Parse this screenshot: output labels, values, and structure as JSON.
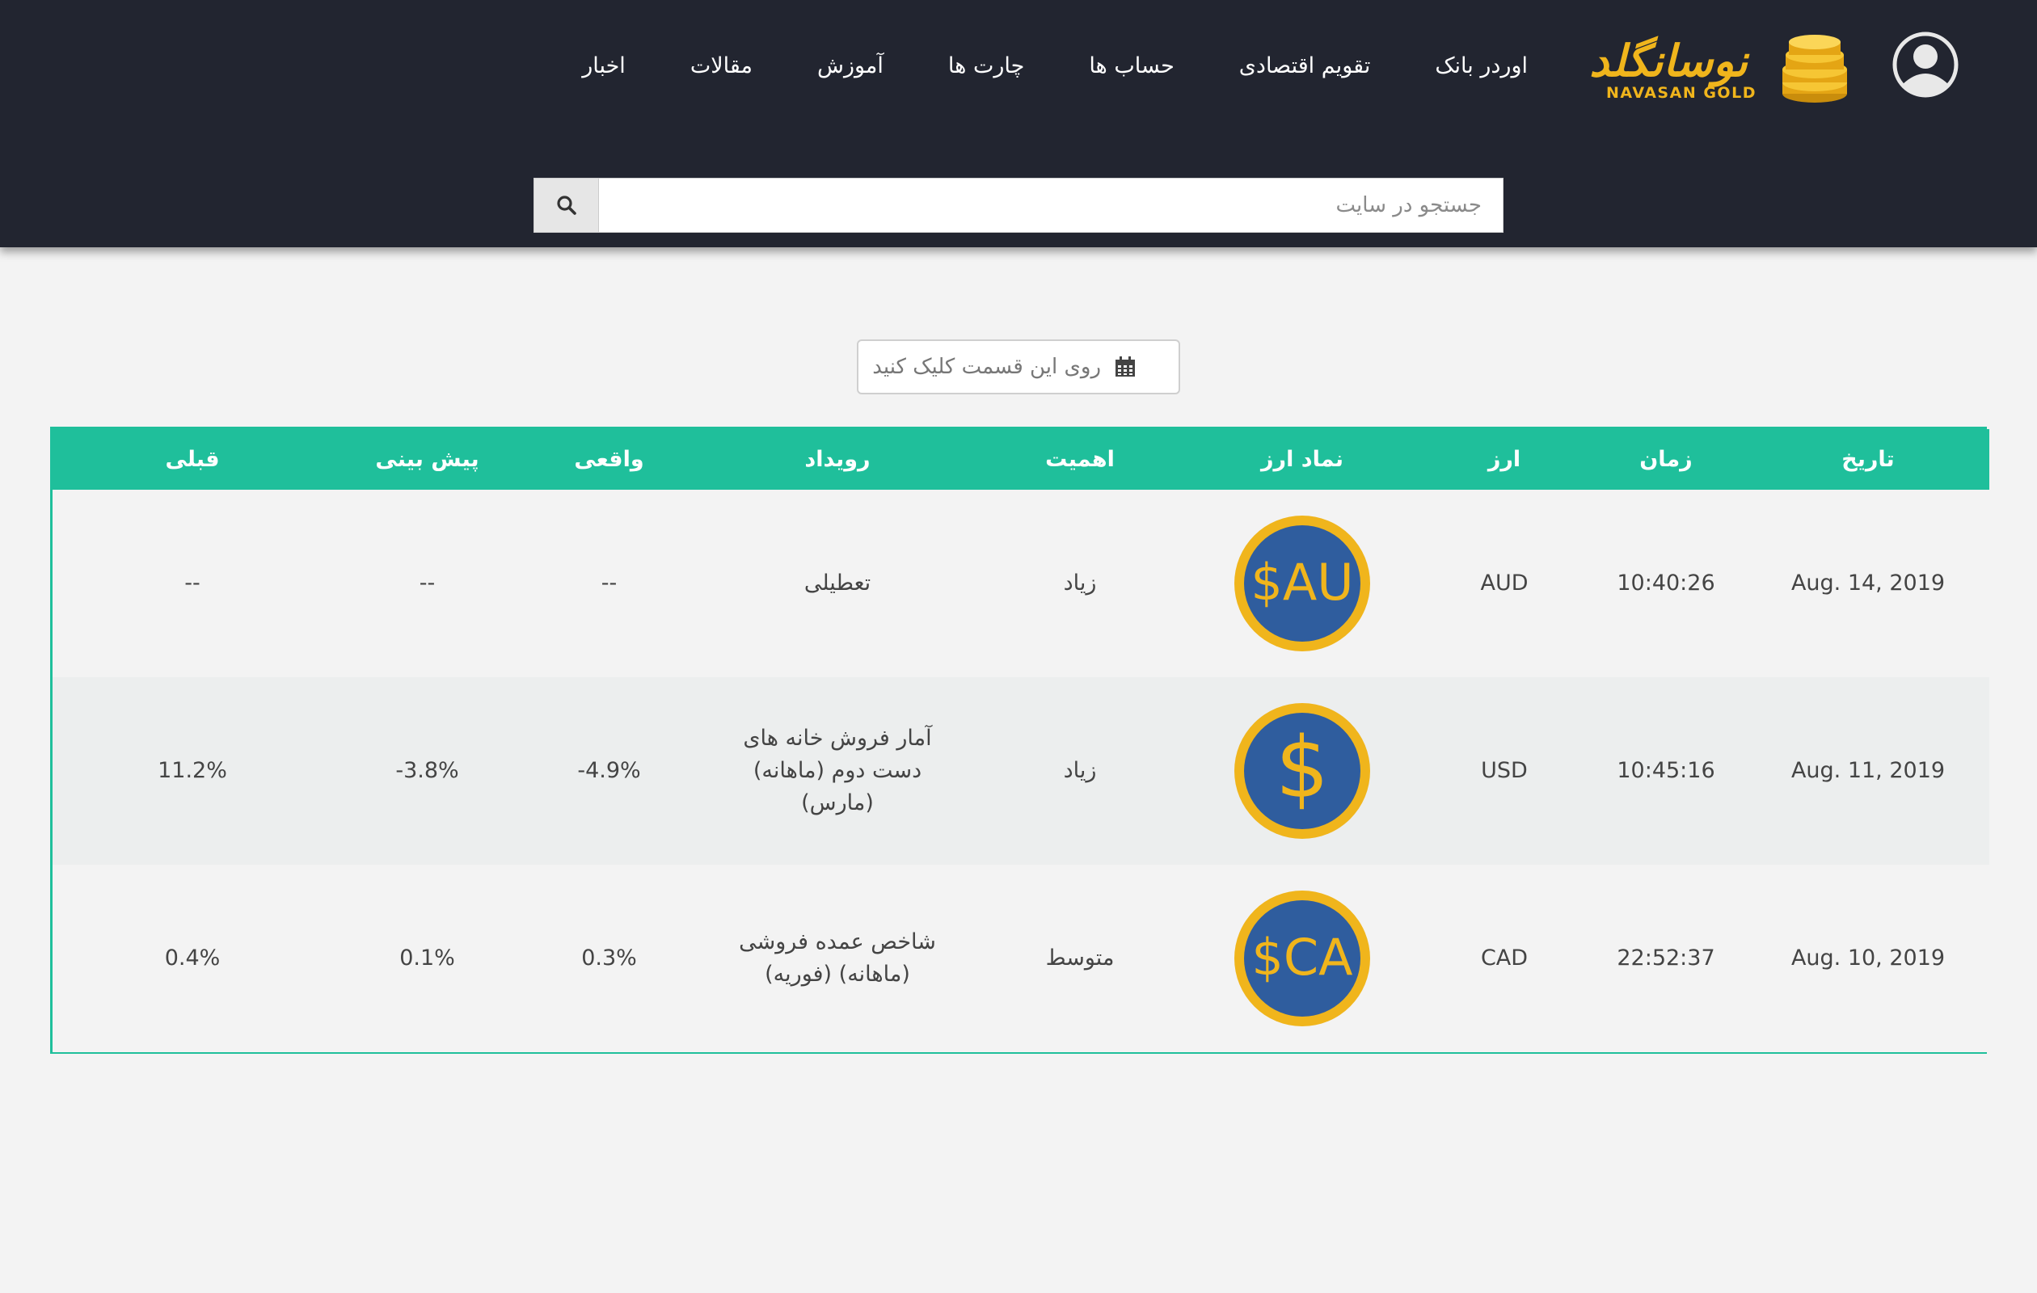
{
  "header": {
    "logo_text": "نوسانگلد",
    "logo_sub": "NAVASAN GOLD",
    "nav": [
      "اخبار",
      "مقالات",
      "آموزش",
      "چارت ها",
      "حساب ها",
      "تقویم اقتصادی",
      "اوردر بانک"
    ],
    "search_placeholder": "جستجو در سایت"
  },
  "date_picker": {
    "placeholder": "روی این قسمت کلیک کنید"
  },
  "table": {
    "headers": [
      "تاریخ",
      "زمان",
      "ارز",
      "نماد ارز",
      "اهمیت",
      "رویداد",
      "واقعی",
      "پیش بینی",
      "قبلی"
    ],
    "rows": [
      {
        "date": "Aug. 14, 2019",
        "time": "10:40:26",
        "currency": "AUD",
        "symbol": "AU$",
        "importance": "زیاد",
        "event": "تعطیلی",
        "actual": "--",
        "forecast": "--",
        "previous": "--"
      },
      {
        "date": "Aug. 11, 2019",
        "time": "10:45:16",
        "currency": "USD",
        "symbol": "$",
        "importance": "زیاد",
        "event": "آمار فروش خانه های دست دوم (ماهانه) (مارس)",
        "actual": "-4.9%",
        "forecast": "-3.8%",
        "previous": "11.2%"
      },
      {
        "date": "Aug. 10, 2019",
        "time": "22:52:37",
        "currency": "CAD",
        "symbol": "CA$",
        "importance": "متوسط",
        "event": "شاخص عمده فروشی (ماهانه) (فوریه)",
        "actual": "0.3%",
        "forecast": "0.1%",
        "previous": "0.4%"
      }
    ]
  },
  "colors": {
    "header_bg": "#222530",
    "accent": "#1fbf9b",
    "coin_blue": "#2f5d9e",
    "coin_gold": "#f0b51c"
  },
  "icons": [
    "user-icon",
    "coins-icon",
    "search-icon",
    "calendar-icon"
  ]
}
